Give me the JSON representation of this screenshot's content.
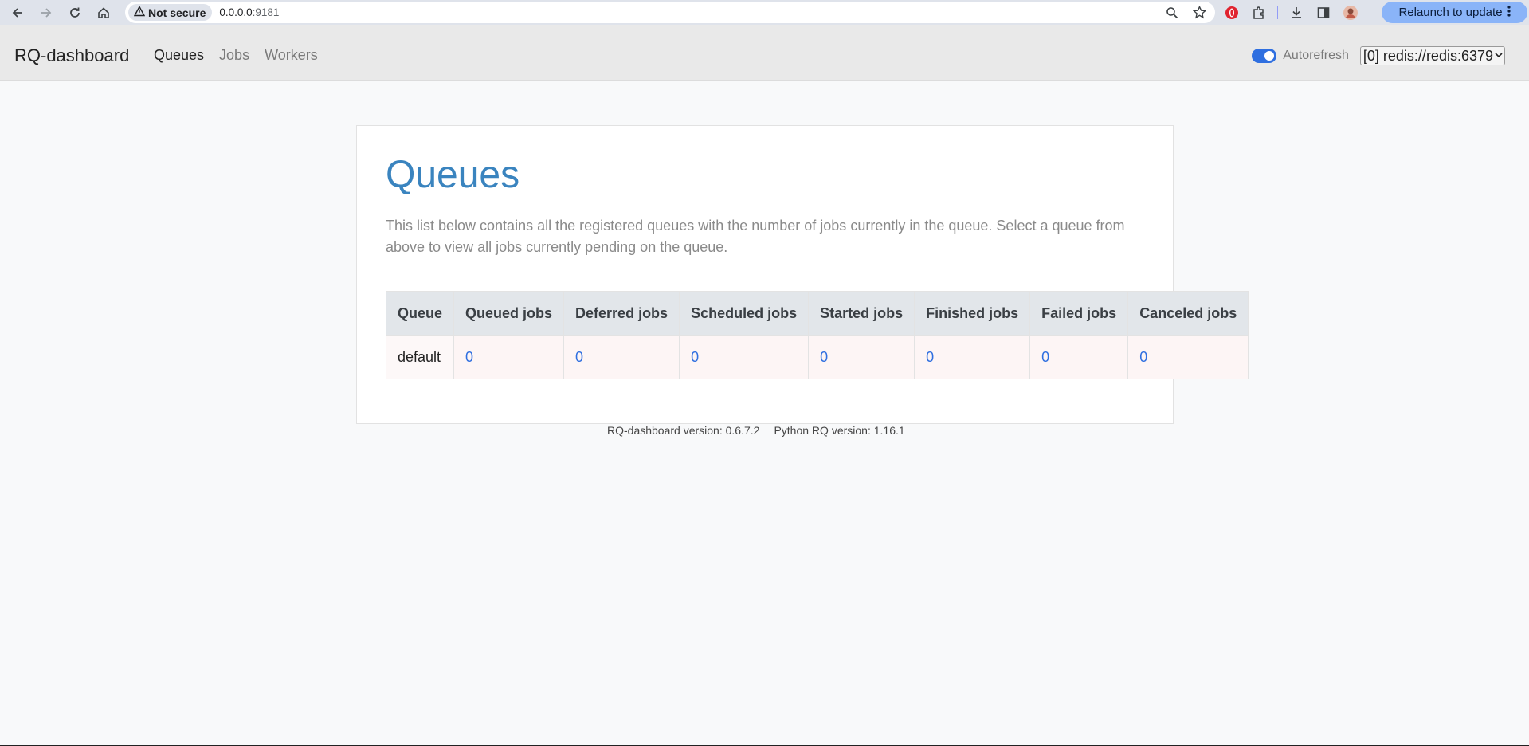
{
  "browser": {
    "security_label": "Not secure",
    "url_host": "0.0.0.0",
    "url_port": ":9181",
    "relaunch_label": "Relaunch to update"
  },
  "navbar": {
    "brand": "RQ-dashboard",
    "links": [
      {
        "label": "Queues",
        "active": true
      },
      {
        "label": "Jobs",
        "active": false
      },
      {
        "label": "Workers",
        "active": false
      }
    ],
    "autorefresh_label": "Autorefresh",
    "autorefresh_on": true,
    "redis_instance": "[0] redis://redis:6379"
  },
  "main": {
    "title": "Queues",
    "intro": "This list below contains all the registered queues with the number of jobs currently in the queue. Select a queue from above to view all jobs currently pending on the queue.",
    "table": {
      "headers": [
        "Queue",
        "Queued jobs",
        "Deferred jobs",
        "Scheduled jobs",
        "Started jobs",
        "Finished jobs",
        "Failed jobs",
        "Canceled jobs"
      ],
      "rows": [
        {
          "queue": "default",
          "queued": "0",
          "deferred": "0",
          "scheduled": "0",
          "started": "0",
          "finished": "0",
          "failed": "0",
          "canceled": "0"
        }
      ]
    }
  },
  "footer": {
    "dashboard_version": "RQ-dashboard version: 0.6.7.2",
    "rq_version": "Python RQ version: 1.16.1"
  },
  "colors": {
    "accent": "#3a84bf",
    "link": "#2f6fe0",
    "toggle": "#2f6fe0"
  }
}
